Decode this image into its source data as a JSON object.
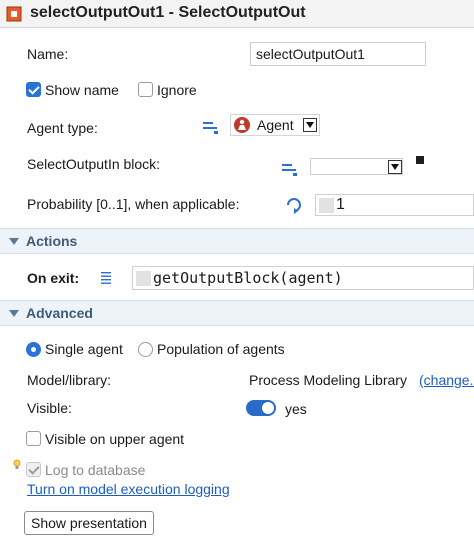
{
  "title": "selectOutputOut1 - SelectOutputOut",
  "colors": {
    "accent": "#2a72d8",
    "link": "#1c5cc7",
    "section_bg": "#eef3f9",
    "agent_icon": "#c0392b"
  },
  "icons": {
    "title": "port-icon",
    "static_value": "equals-icon",
    "dynamic": "dynamic-refresh-icon",
    "code": "code-lines-icon",
    "agent": "agent-icon",
    "hint": "lightbulb-icon"
  },
  "fields": {
    "name_label": "Name:",
    "name_value": "selectOutputOut1",
    "show_name_label": "Show name",
    "show_name_checked": true,
    "ignore_label": "Ignore",
    "ignore_checked": false,
    "agent_type_label": "Agent type:",
    "agent_type_value": "Agent",
    "select_in_label": "SelectOutputIn block:",
    "select_in_value": "",
    "probability_label": "Probability [0..1], when applicable:",
    "probability_value": "1"
  },
  "actions": {
    "section_title": "Actions",
    "on_exit_label": "On exit:",
    "on_exit_code": "getOutputBlock(agent)"
  },
  "advanced": {
    "section_title": "Advanced",
    "single_agent_label": "Single agent",
    "population_label": "Population of agents",
    "selected_option": "Single agent",
    "model_library_label": "Model/library:",
    "model_library_value": "Process Modeling Library",
    "change_link": "(change...)",
    "visible_label": "Visible:",
    "visible_value": "yes",
    "visible_upper_label": "Visible on upper agent",
    "visible_upper_checked": false,
    "log_label": "Log to database",
    "log_checked": true,
    "logging_link": "Turn on model execution logging",
    "show_presentation_button": "Show presentation"
  }
}
